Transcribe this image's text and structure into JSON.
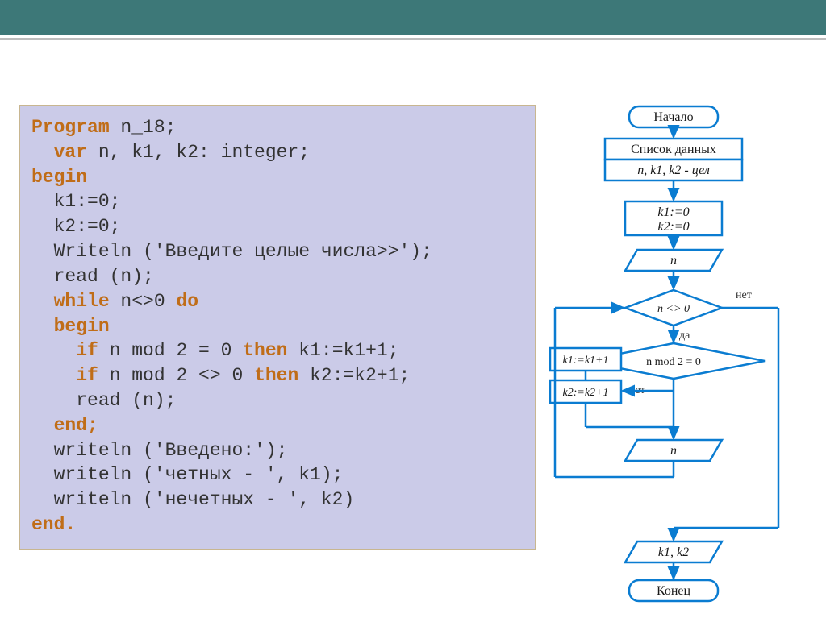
{
  "code": {
    "line01a": "Program",
    "line01b": " n_18;",
    "line02a": "  var",
    "line02b": " n, k1, k2: integer;",
    "line03a": "begin",
    "line04": "  k1:=0;",
    "line05": "  k2:=0;",
    "line06": "  Writeln ('Введите целые числа>>');",
    "line07": "  read (n);",
    "line08a": "  while ",
    "line08b": "n<>0",
    "line08c": " do",
    "line09a": "  begin",
    "line10a": "    if ",
    "line10b": "n mod 2 = 0",
    "line10c": " then ",
    "line10d": "k1:=k1+1;",
    "line11a": "    if ",
    "line11b": "n mod 2 <> 0",
    "line11c": " then ",
    "line11d": "k2:=k2+1;",
    "line12": "    read (n);",
    "line13a": "  end;",
    "line14": "  writeln ('Введено:');",
    "line15": "  writeln ('четных - ', k1);",
    "line16": "  writeln ('нечетных - ', k2)",
    "line17a": "end."
  },
  "flowchart": {
    "start": "Начало",
    "data_list": "Список данных",
    "vars_decl": "n, k1, k2 - цел",
    "init1": "k1:=0",
    "init2": "k2:=0",
    "input_n1": "n",
    "cond": "n <> 0",
    "mod_expr": "n mod 2 = 0",
    "assign_k1": "k1:=k1+1",
    "assign_k2": "k2:=k2+1",
    "input_n2": "n",
    "output": "k1, k2",
    "end": "Конец",
    "yes": "да",
    "no": "нет"
  }
}
